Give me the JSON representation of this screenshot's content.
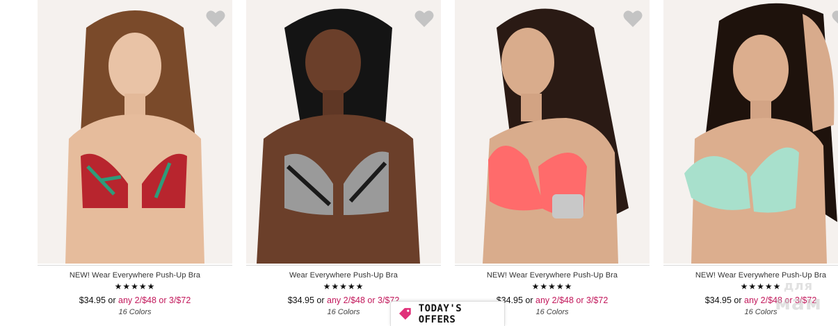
{
  "products": [
    {
      "name": "NEW! Wear Everywhere Push-Up Bra",
      "rating": 4.5,
      "stars": "★★★★★",
      "price": "$34.95 or",
      "offer": "any 2/$48 or 3/$72",
      "colors": "16 Colors",
      "swatch": "#b8252e",
      "hair": "#7a4a2a"
    },
    {
      "name": "Wear Everywhere Push-Up Bra",
      "rating": 4.5,
      "stars": "★★★★★",
      "price": "$34.95 or",
      "offer": "any 2/$48 or 3/$72",
      "colors": "16 Colors",
      "swatch": "#9a9a9a",
      "hair": "#141414"
    },
    {
      "name": "NEW! Wear Everywhere Push-Up Bra",
      "rating": 4.5,
      "stars": "★★★★★",
      "price": "$34.95 or",
      "offer": "any 2/$48 or 3/$72",
      "colors": "16 Colors",
      "swatch": "#ff6b6b",
      "hair": "#2a1a14"
    },
    {
      "name": "NEW! Wear Everywhere Push-Up Bra",
      "rating": 4.5,
      "stars": "★★★★★",
      "price": "$34.95 or",
      "offer": "any 2/$48 or 3/$72",
      "colors": "16 Colors",
      "swatch": "#a8e0cc",
      "hair": "#1e120c"
    }
  ],
  "todays_offers": {
    "label": "TODAY'S OFFERS",
    "icon": "tag-icon"
  },
  "watermark": {
    "line1": "для",
    "line2": "мам"
  },
  "colors": {
    "offer_pink": "#c2185b",
    "heart_gray": "#c4c4c4"
  }
}
